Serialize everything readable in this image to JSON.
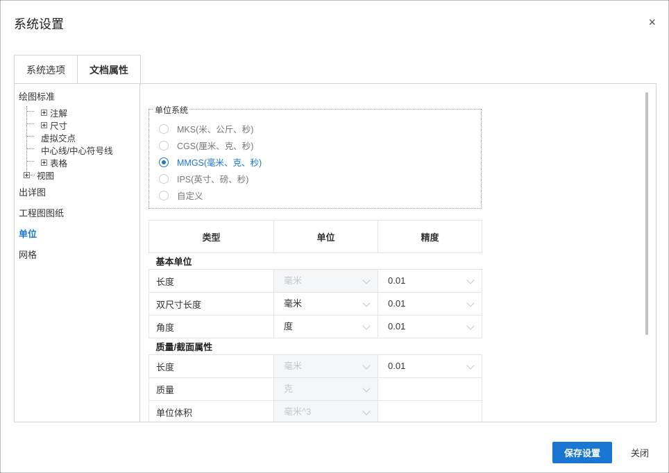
{
  "dialog": {
    "title": "系统设置",
    "close_glyph": "×"
  },
  "tabs": [
    {
      "label": "系统选项",
      "active": false
    },
    {
      "label": "文档属性",
      "active": true
    }
  ],
  "sidebar": {
    "drawing_standard": "绘图标准",
    "children": [
      "注解",
      "尺寸",
      "虚拟交点",
      "中心线/中心符号线",
      "表格",
      "视图"
    ],
    "detailing": "出详图",
    "drawing_sheet": "工程图图纸",
    "units": "单位",
    "grid": "网格"
  },
  "unit_system": {
    "legend": "单位系统",
    "options": [
      "MKS(米、公斤、秒)",
      "CGS(厘米、克、秒)",
      "MMGS(毫米、克、秒)",
      "IPS(英寸、磅、秒)",
      "自定义"
    ],
    "selected": "MMGS(毫米、克、秒)"
  },
  "units_table": {
    "headers": [
      "类型",
      "单位",
      "精度"
    ],
    "basic_section": "基本单位",
    "mass_section": "质量/截面属性",
    "basic_rows": [
      {
        "label": "长度",
        "unit": "毫米",
        "precision": "0.01"
      },
      {
        "label": "双尺寸长度",
        "unit": "毫米",
        "precision": "0.01"
      },
      {
        "label": "角度",
        "unit": "度",
        "precision": "0.01"
      }
    ],
    "mass_rows": [
      {
        "label": "长度",
        "unit": "毫米",
        "precision": "0.01"
      },
      {
        "label": "质量",
        "unit": "克"
      },
      {
        "label": "单位体积",
        "unit": "毫米^3"
      }
    ]
  },
  "footer": {
    "save_label": "保存设置",
    "close_label": "关闭"
  },
  "colors": {
    "accent": "#1976d2"
  }
}
